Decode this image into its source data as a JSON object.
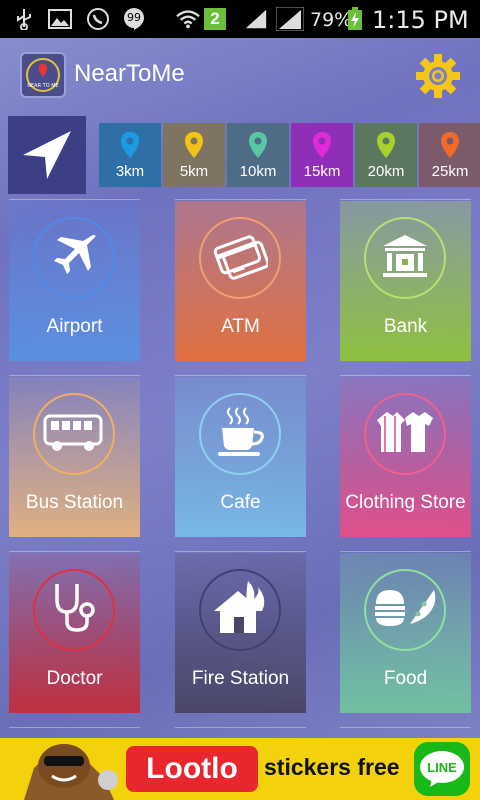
{
  "status_bar": {
    "notification_badge": "2",
    "battery_percent": "79%",
    "time": "1:15 PM"
  },
  "header": {
    "logo_text": "NEAR TO ME",
    "title": "NearToMe"
  },
  "distances": [
    {
      "label": "3km",
      "bg": "#2f6fa8",
      "pin": "#1e9be0"
    },
    {
      "label": "5km",
      "bg": "#7f7462",
      "pin": "#f0c419"
    },
    {
      "label": "10km",
      "bg": "#4f6c86",
      "pin": "#57c7a5"
    },
    {
      "label": "15km",
      "bg": "#8f2fb8",
      "pin": "#e12bd9"
    },
    {
      "label": "20km",
      "bg": "#5b7760",
      "pin": "#a8d12c"
    },
    {
      "label": "25km",
      "bg": "#7b5a6a",
      "pin": "#f06a2a"
    }
  ],
  "categories": [
    {
      "label": "Airport",
      "icon": "airplane-icon",
      "ring": "#4d8be6"
    },
    {
      "label": "ATM",
      "icon": "atm-card-icon",
      "ring": "#f0a070"
    },
    {
      "label": "Bank",
      "icon": "bank-icon",
      "ring": "#b8e070"
    },
    {
      "label": "Bus Station",
      "icon": "bus-icon",
      "ring": "#f0b060"
    },
    {
      "label": "Cafe",
      "icon": "coffee-cup-icon",
      "ring": "#8fd0f0"
    },
    {
      "label": "Clothing Store",
      "icon": "clothing-icon",
      "ring": "#f06090"
    },
    {
      "label": "Doctor",
      "icon": "stethoscope-icon",
      "ring": "#e03040"
    },
    {
      "label": "Fire Station",
      "icon": "fire-station-icon",
      "ring": "#404070"
    },
    {
      "label": "Food",
      "icon": "food-icon",
      "ring": "#90e0a0"
    }
  ],
  "ad": {
    "brand": "Lootlo",
    "text": "stickers free",
    "line_logo": "LINE"
  }
}
